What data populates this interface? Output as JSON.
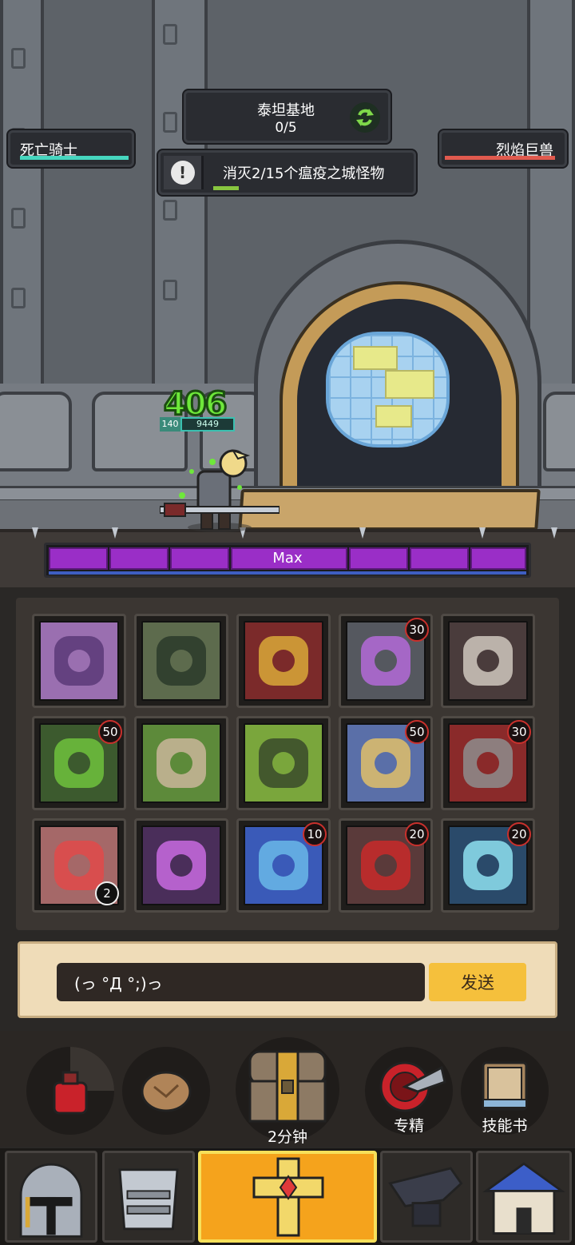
{
  "stage": {
    "name": "泰坦基地",
    "progress": "0/5"
  },
  "quest": {
    "text": "消灭2/15个瘟疫之城怪物",
    "progress_fraction": 0.13
  },
  "player_plate": {
    "name": "死亡骑士",
    "hp_fraction": 1.0
  },
  "enemy_plate": {
    "name": "烈焰巨兽",
    "hp_fraction": 1.0
  },
  "hero": {
    "damage_popup": "406",
    "level": "140",
    "hp_text": "9449"
  },
  "max_bar": {
    "label": "Max",
    "segments": 8
  },
  "skills": [
    {
      "badge": "",
      "icon": "skull-swarm-icon"
    },
    {
      "badge": "",
      "icon": "grave-hand-icon"
    },
    {
      "badge": "",
      "icon": "demon-armor-icon"
    },
    {
      "badge": "30",
      "icon": "lightning-golem-icon"
    },
    {
      "badge": "",
      "icon": "screaming-skull-icon"
    },
    {
      "badge": "50",
      "icon": "toxic-skull-icon"
    },
    {
      "badge": "",
      "icon": "ghoul-icon"
    },
    {
      "badge": "",
      "icon": "dragon-head-icon"
    },
    {
      "badge": "50",
      "icon": "eye-spear-icon"
    },
    {
      "badge": "30",
      "icon": "bloody-hammer-icon"
    },
    {
      "badge": "",
      "badge_bottom": "2",
      "icon": "red-shatter-icon"
    },
    {
      "badge": "",
      "icon": "purple-vortex-icon"
    },
    {
      "badge": "10",
      "icon": "frost-demon-icon"
    },
    {
      "badge": "20",
      "icon": "blood-rose-icon"
    },
    {
      "badge": "20",
      "icon": "frost-breath-icon"
    }
  ],
  "chat": {
    "input_value": "(っ °Д °;)っ",
    "send_label": "发送"
  },
  "actions": {
    "potion_icon": "potion-icon",
    "bread_icon": "bread-icon",
    "chest_label": "2分钟",
    "mastery_label": "专精",
    "skillbook_label": "技能书"
  },
  "nav": [
    "helmet-icon",
    "armor-icon",
    "cross-icon",
    "anvil-icon",
    "town-icon"
  ],
  "colors": {
    "accent": "#f5c03c",
    "purple": "#9a2ec7",
    "hp_green": "#46d6bf",
    "hp_red": "#e05a4e"
  }
}
